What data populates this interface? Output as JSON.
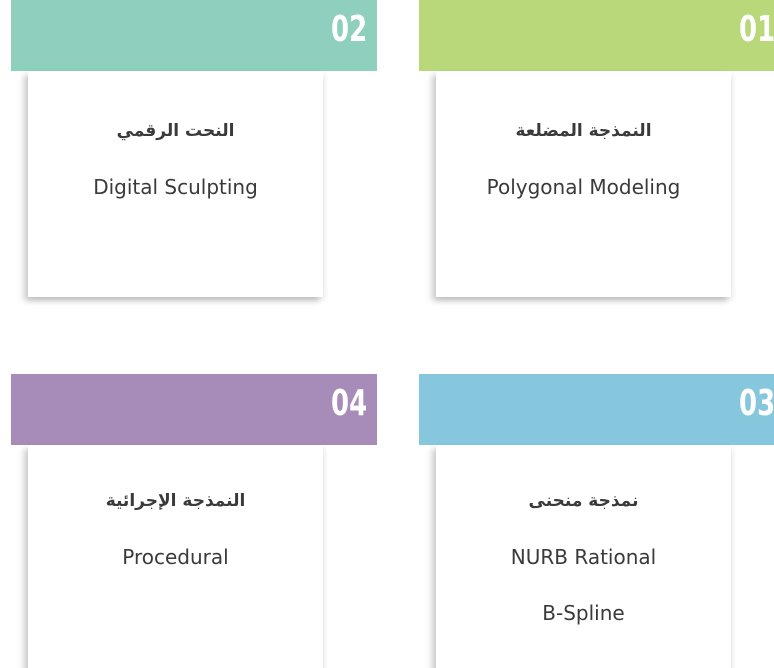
{
  "colors": {
    "green": "#b8d87a",
    "teal": "#8ecfbd",
    "blue": "#87c7dd",
    "purple": "#a78bb8",
    "text": "#3a3a3a"
  },
  "cards": [
    {
      "number": "01",
      "arabic": "النمذجة المضلعة",
      "english_lines": [
        "Polygonal Modeling"
      ]
    },
    {
      "number": "02",
      "arabic": "النحت الرقمي",
      "english_lines": [
        "Digital Sculpting"
      ]
    },
    {
      "number": "03",
      "arabic": "نمذجة منحنى",
      "english_lines": [
        "NURB Rational",
        "B-Spline"
      ]
    },
    {
      "number": "04",
      "arabic": "النمذجة الإجرائية",
      "english_lines": [
        "Procedural"
      ]
    }
  ]
}
